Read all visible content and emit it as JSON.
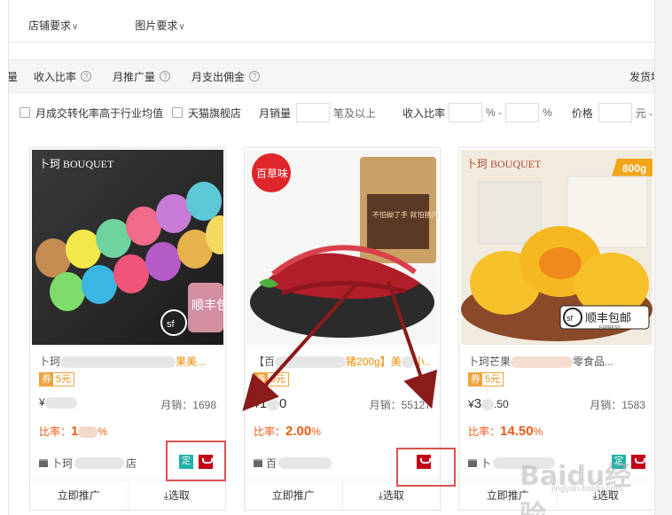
{
  "filters": [
    "店铺要求",
    "图片要求"
  ],
  "sort_bar": {
    "first_partial": "量",
    "items": [
      "收入比率",
      "月推广量",
      "月支出佣金"
    ],
    "right_partial": "发货地"
  },
  "conditions": {
    "cb1_label": "月成交转化率高于行业均值",
    "cb2_label": "天猫旗舰店",
    "monthly_sales_label": "月销量",
    "monthly_sales_suffix": "笔及以上",
    "income_ratio_label": "收入比率",
    "percent1": "% -",
    "percent2": "%",
    "price_label": "价格",
    "price_unit": "元 -"
  },
  "products": [
    {
      "title_a": "卜珂",
      "title_b": "果美...",
      "coupon_label": "券",
      "coupon_value": "5元",
      "price_prefix": "¥",
      "price": "",
      "sales": "月销：1698",
      "rate_label": "比率：",
      "rate_value": "1",
      "rate_unit": "%",
      "shop": "卜珂",
      "shop_tail": "店",
      "badge_ding": "定",
      "brand": "卜珂 BOUQUET",
      "img_overlay": "顺丰包邮",
      "action_promote": "立即推广",
      "action_select": "⤓选取"
    },
    {
      "title_a": "【百",
      "title_b": "猪200g】美",
      "title_c": "小...",
      "coupon_label": "券",
      "coupon_value": "5元",
      "price_prefix": "¥",
      "price": "1",
      "price_tail": "0",
      "sales": "月销：55127",
      "rate_label": "比率：",
      "rate_value": "2.00",
      "rate_unit": "%",
      "shop": "百",
      "brand": "百草味",
      "pack_text": "不怕拗了手 就怕猪肉",
      "action_promote": "立即推广",
      "action_select": "⤓选取"
    },
    {
      "title_a": "卜珂芒果",
      "title_b": "零食品...",
      "coupon_label": "券",
      "coupon_value": "5元",
      "price_prefix": "¥",
      "price": "3",
      "price_tail": ".50",
      "sales": "月销：1583",
      "rate_label": "比率：",
      "rate_value": "14.50",
      "rate_unit": "%",
      "shop": "卜",
      "badge_ding": "定",
      "brand": "卜珂 BOUQUET",
      "weight_tag": "800g",
      "img_overlay": "顺丰包邮",
      "img_overlay_sub": "EXPRESS",
      "action_promote": "立即推广",
      "action_select": "⤓选取"
    }
  ],
  "watermark": "Baidu经验",
  "watermark_sub": "jingyan.baidu.com",
  "colors": {
    "accent": "#f05a14",
    "coupon": "#f0a23c",
    "tmall": "#c40018",
    "ding": "#1fb2a6",
    "annotation": "#d9534f",
    "arrow": "#8b1a1a"
  }
}
